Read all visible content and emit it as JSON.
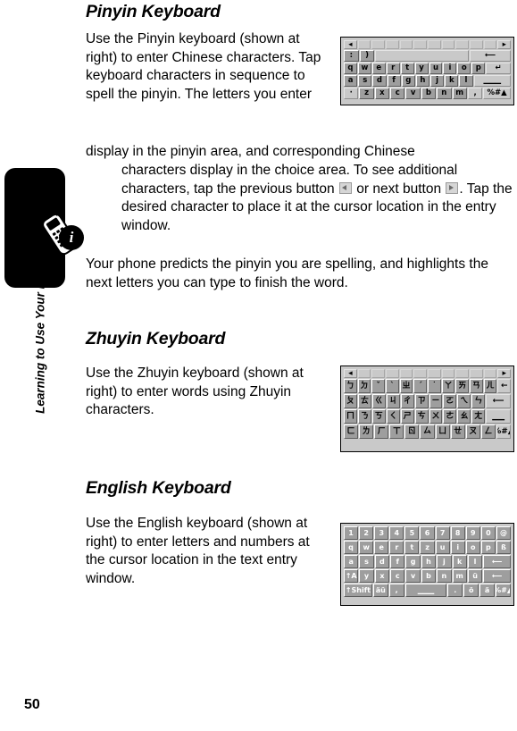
{
  "sidebar": {
    "vertical_label": "Learning to Use Your Phone",
    "page_number": "50",
    "info_glyph": "i"
  },
  "sections": [
    {
      "heading": "Pinyin Keyboard",
      "paragraph_1": "Use the Pinyin keyboard (shown at right) to enter Chinese characters. Tap keyboard characters in sequence to spell the pinyin. The letters you enter display in the pinyin area, and corresponding Chinese characters display in the choice area. To see additional characters, tap the previous button",
      "paragraph_1_mid": "or next button",
      "paragraph_1_end": ". Tap the desired character to place it at the cursor location in the entry window.",
      "paragraph_2": "Your phone predicts the pinyin you are spelling, and highlights the next letters you can type to finish the word."
    },
    {
      "heading": "Zhuyin Keyboard",
      "paragraph_1": "Use the Zhuyin keyboard (shown at right) to enter words using Zhuyin characters."
    },
    {
      "heading": "English Keyboard",
      "paragraph_1": "Use the English keyboard (shown at right) to enter letters and numbers at the cursor location in the text entry window."
    }
  ],
  "keyboards": {
    "pinyin": {
      "name": "pinyin-keyboard",
      "rows": [
        [
          {
            "label": "◂",
            "w": 1,
            "style": "light"
          },
          {
            "label": "",
            "w": 1,
            "style": "blank"
          },
          {
            "label": "",
            "w": 1,
            "style": "blank"
          },
          {
            "label": "",
            "w": 1,
            "style": "blank"
          },
          {
            "label": "",
            "w": 1,
            "style": "blank"
          },
          {
            "label": "",
            "w": 1,
            "style": "blank"
          },
          {
            "label": "",
            "w": 1,
            "style": "blank"
          },
          {
            "label": "",
            "w": 1,
            "style": "blank"
          },
          {
            "label": "",
            "w": 1,
            "style": "blank"
          },
          {
            "label": "",
            "w": 1,
            "style": "blank"
          },
          {
            "label": "",
            "w": 1,
            "style": "blank"
          },
          {
            "label": "▸",
            "w": 1,
            "style": "light"
          }
        ],
        [
          {
            "label": ":",
            "w": 1,
            "style": "key"
          },
          {
            "label": ")",
            "w": 1,
            "style": "key"
          },
          {
            "label": "",
            "w": 7,
            "style": "light"
          },
          {
            "label": "⟵",
            "w": 3,
            "style": "light"
          }
        ],
        [
          {
            "label": "q",
            "w": 1,
            "style": "key"
          },
          {
            "label": "w",
            "w": 1,
            "style": "key"
          },
          {
            "label": "e",
            "w": 1,
            "style": "key"
          },
          {
            "label": "r",
            "w": 1,
            "style": "key"
          },
          {
            "label": "t",
            "w": 1,
            "style": "key"
          },
          {
            "label": "y",
            "w": 1,
            "style": "key"
          },
          {
            "label": "u",
            "w": 1,
            "style": "key"
          },
          {
            "label": "i",
            "w": 1,
            "style": "key"
          },
          {
            "label": "o",
            "w": 1,
            "style": "key"
          },
          {
            "label": "p",
            "w": 1,
            "style": "key"
          },
          {
            "label": "↵",
            "w": 2,
            "style": "light"
          }
        ],
        [
          {
            "label": "a",
            "w": 1,
            "style": "key"
          },
          {
            "label": "s",
            "w": 1,
            "style": "key"
          },
          {
            "label": "d",
            "w": 1,
            "style": "key"
          },
          {
            "label": "f",
            "w": 1,
            "style": "key"
          },
          {
            "label": "g",
            "w": 1,
            "style": "key"
          },
          {
            "label": "h",
            "w": 1,
            "style": "key"
          },
          {
            "label": "j",
            "w": 1,
            "style": "key"
          },
          {
            "label": "k",
            "w": 1,
            "style": "key"
          },
          {
            "label": "l",
            "w": 1,
            "style": "key"
          },
          {
            "label": "▁▁▁",
            "w": 3,
            "style": "light"
          }
        ],
        [
          {
            "label": "·",
            "w": 1,
            "style": "light"
          },
          {
            "label": "z",
            "w": 1,
            "style": "key"
          },
          {
            "label": "x",
            "w": 1,
            "style": "key"
          },
          {
            "label": "c",
            "w": 1,
            "style": "key"
          },
          {
            "label": "v",
            "w": 1,
            "style": "key"
          },
          {
            "label": "b",
            "w": 1,
            "style": "key"
          },
          {
            "label": "n",
            "w": 1,
            "style": "key"
          },
          {
            "label": "m",
            "w": 1,
            "style": "key"
          },
          {
            "label": ",",
            "w": 1,
            "style": "light"
          },
          {
            "label": "%#▲",
            "w": 2,
            "style": "light"
          }
        ]
      ]
    },
    "zhuyin": {
      "name": "zhuyin-keyboard",
      "rows": [
        [
          {
            "label": "◂",
            "w": 1,
            "style": "light"
          },
          {
            "label": "",
            "w": 1,
            "style": "blank"
          },
          {
            "label": "",
            "w": 1,
            "style": "blank"
          },
          {
            "label": "",
            "w": 1,
            "style": "blank"
          },
          {
            "label": "",
            "w": 1,
            "style": "blank"
          },
          {
            "label": "",
            "w": 1,
            "style": "blank"
          },
          {
            "label": "",
            "w": 1,
            "style": "blank"
          },
          {
            "label": "",
            "w": 1,
            "style": "blank"
          },
          {
            "label": "",
            "w": 1,
            "style": "blank"
          },
          {
            "label": "",
            "w": 1,
            "style": "blank"
          },
          {
            "label": "",
            "w": 1,
            "style": "blank"
          },
          {
            "label": "▸",
            "w": 1,
            "style": "light"
          }
        ],
        [
          {
            "label": "ㄅ",
            "w": 1,
            "style": "key"
          },
          {
            "label": "ㄉ",
            "w": 1,
            "style": "key"
          },
          {
            "label": "ˇ",
            "w": 1,
            "style": "key"
          },
          {
            "label": "ˋ",
            "w": 1,
            "style": "key"
          },
          {
            "label": "ㄓ",
            "w": 1,
            "style": "key"
          },
          {
            "label": "ˊ",
            "w": 1,
            "style": "key"
          },
          {
            "label": "˙",
            "w": 1,
            "style": "key"
          },
          {
            "label": "ㄚ",
            "w": 1,
            "style": "key"
          },
          {
            "label": "ㄞ",
            "w": 1,
            "style": "key"
          },
          {
            "label": "ㄢ",
            "w": 1,
            "style": "key"
          },
          {
            "label": "ㄦ",
            "w": 1,
            "style": "key"
          },
          {
            "label": "←",
            "w": 1,
            "style": "light"
          }
        ],
        [
          {
            "label": "ㄆ",
            "w": 1,
            "style": "key"
          },
          {
            "label": "ㄊ",
            "w": 1,
            "style": "key"
          },
          {
            "label": "ㄍ",
            "w": 1,
            "style": "key"
          },
          {
            "label": "ㄐ",
            "w": 1,
            "style": "key"
          },
          {
            "label": "ㄔ",
            "w": 1,
            "style": "key"
          },
          {
            "label": "ㄗ",
            "w": 1,
            "style": "key"
          },
          {
            "label": "ㄧ",
            "w": 1,
            "style": "key"
          },
          {
            "label": "ㄛ",
            "w": 1,
            "style": "key"
          },
          {
            "label": "ㄟ",
            "w": 1,
            "style": "key"
          },
          {
            "label": "ㄣ",
            "w": 1,
            "style": "key"
          },
          {
            "label": "⟵",
            "w": 2,
            "style": "light"
          }
        ],
        [
          {
            "label": "ㄇ",
            "w": 1,
            "style": "key"
          },
          {
            "label": "ㄋ",
            "w": 1,
            "style": "key"
          },
          {
            "label": "ㄎ",
            "w": 1,
            "style": "key"
          },
          {
            "label": "ㄑ",
            "w": 1,
            "style": "key"
          },
          {
            "label": "ㄕ",
            "w": 1,
            "style": "key"
          },
          {
            "label": "ㄘ",
            "w": 1,
            "style": "key"
          },
          {
            "label": "ㄨ",
            "w": 1,
            "style": "key"
          },
          {
            "label": "ㄜ",
            "w": 1,
            "style": "key"
          },
          {
            "label": "ㄠ",
            "w": 1,
            "style": "key"
          },
          {
            "label": "ㄤ",
            "w": 1,
            "style": "key"
          },
          {
            "label": "▁▁",
            "w": 2,
            "style": "light"
          }
        ],
        [
          {
            "label": "ㄈ",
            "w": 1,
            "style": "key"
          },
          {
            "label": "ㄌ",
            "w": 1,
            "style": "key"
          },
          {
            "label": "ㄏ",
            "w": 1,
            "style": "key"
          },
          {
            "label": "ㄒ",
            "w": 1,
            "style": "key"
          },
          {
            "label": "ㄖ",
            "w": 1,
            "style": "key"
          },
          {
            "label": "ㄙ",
            "w": 1,
            "style": "key"
          },
          {
            "label": "ㄩ",
            "w": 1,
            "style": "key"
          },
          {
            "label": "ㄝ",
            "w": 1,
            "style": "key"
          },
          {
            "label": "ㄡ",
            "w": 1,
            "style": "key"
          },
          {
            "label": "ㄥ",
            "w": 1,
            "style": "key"
          },
          {
            "label": "%#▲",
            "w": 1,
            "style": "light"
          }
        ]
      ]
    },
    "english": {
      "name": "english-keyboard",
      "rows": [
        [
          {
            "label": "1",
            "w": 1,
            "style": "key"
          },
          {
            "label": "2",
            "w": 1,
            "style": "key"
          },
          {
            "label": "3",
            "w": 1,
            "style": "key"
          },
          {
            "label": "4",
            "w": 1,
            "style": "key"
          },
          {
            "label": "5",
            "w": 1,
            "style": "key"
          },
          {
            "label": "6",
            "w": 1,
            "style": "key"
          },
          {
            "label": "7",
            "w": 1,
            "style": "key"
          },
          {
            "label": "8",
            "w": 1,
            "style": "key"
          },
          {
            "label": "9",
            "w": 1,
            "style": "key"
          },
          {
            "label": "0",
            "w": 1,
            "style": "key"
          },
          {
            "label": "@",
            "w": 1,
            "style": "key"
          }
        ],
        [
          {
            "label": "q",
            "w": 1,
            "style": "key"
          },
          {
            "label": "w",
            "w": 1,
            "style": "key"
          },
          {
            "label": "e",
            "w": 1,
            "style": "key"
          },
          {
            "label": "r",
            "w": 1,
            "style": "key"
          },
          {
            "label": "t",
            "w": 1,
            "style": "key"
          },
          {
            "label": "z",
            "w": 1,
            "style": "key"
          },
          {
            "label": "u",
            "w": 1,
            "style": "key"
          },
          {
            "label": "i",
            "w": 1,
            "style": "key"
          },
          {
            "label": "o",
            "w": 1,
            "style": "key"
          },
          {
            "label": "p",
            "w": 1,
            "style": "key"
          },
          {
            "label": "ß",
            "w": 1,
            "style": "key"
          }
        ],
        [
          {
            "label": "a",
            "w": 1,
            "style": "key"
          },
          {
            "label": "s",
            "w": 1,
            "style": "key"
          },
          {
            "label": "d",
            "w": 1,
            "style": "key"
          },
          {
            "label": "f",
            "w": 1,
            "style": "key"
          },
          {
            "label": "g",
            "w": 1,
            "style": "key"
          },
          {
            "label": "h",
            "w": 1,
            "style": "key"
          },
          {
            "label": "j",
            "w": 1,
            "style": "key"
          },
          {
            "label": "k",
            "w": 1,
            "style": "key"
          },
          {
            "label": "l",
            "w": 1,
            "style": "key"
          },
          {
            "label": "⟵",
            "w": 2,
            "style": "key"
          }
        ],
        [
          {
            "label": "↑A",
            "w": 1,
            "style": "key"
          },
          {
            "label": "y",
            "w": 1,
            "style": "key"
          },
          {
            "label": "x",
            "w": 1,
            "style": "key"
          },
          {
            "label": "c",
            "w": 1,
            "style": "key"
          },
          {
            "label": "v",
            "w": 1,
            "style": "key"
          },
          {
            "label": "b",
            "w": 1,
            "style": "key"
          },
          {
            "label": "n",
            "w": 1,
            "style": "key"
          },
          {
            "label": "m",
            "w": 1,
            "style": "key"
          },
          {
            "label": "ü",
            "w": 1,
            "style": "key"
          },
          {
            "label": "⟵",
            "w": 2,
            "style": "key"
          }
        ],
        [
          {
            "label": "↑Shift",
            "w": 2,
            "style": "key"
          },
          {
            "label": "äü",
            "w": 1,
            "style": "key"
          },
          {
            "label": ",",
            "w": 1,
            "style": "key"
          },
          {
            "label": "▁▁▁",
            "w": 3,
            "style": "key"
          },
          {
            "label": ".",
            "w": 1,
            "style": "key"
          },
          {
            "label": "ö",
            "w": 1,
            "style": "key"
          },
          {
            "label": "ä",
            "w": 1,
            "style": "key"
          },
          {
            "label": "%#▲",
            "w": 1,
            "style": "key"
          }
        ]
      ]
    }
  }
}
